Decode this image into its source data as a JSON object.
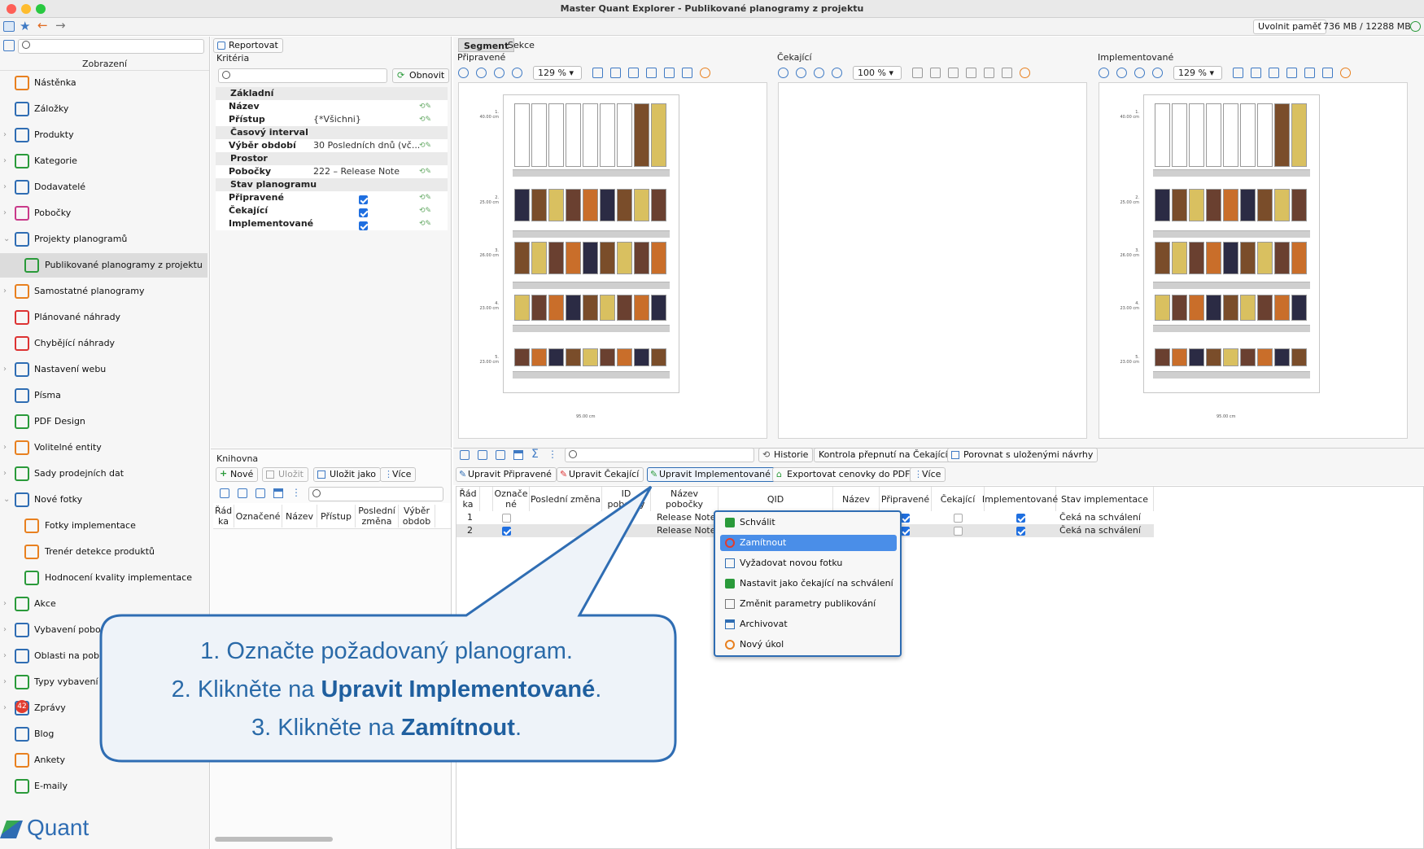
{
  "window": {
    "title": "Master Quant Explorer - Publikované planogramy z projektu"
  },
  "memory": {
    "label": "Uvolnit paměť",
    "value": "736 MB / 12288 MB"
  },
  "sidebar": {
    "section_title": "Zobrazení",
    "items": [
      {
        "label": "Nástěnka"
      },
      {
        "label": "Záložky"
      },
      {
        "label": "Produkty"
      },
      {
        "label": "Kategorie"
      },
      {
        "label": "Dodavatelé"
      },
      {
        "label": "Pobočky"
      },
      {
        "label": "Projekty planogramů"
      },
      {
        "label": "Publikované planogramy z projektu"
      },
      {
        "label": "Samostatné planogramy"
      },
      {
        "label": "Plánované náhrady"
      },
      {
        "label": "Chybějící náhrady"
      },
      {
        "label": "Nastavení webu"
      },
      {
        "label": "Písma"
      },
      {
        "label": "PDF Design"
      },
      {
        "label": "Volitelné entity"
      },
      {
        "label": "Sady prodejních dat"
      },
      {
        "label": "Nové fotky"
      },
      {
        "label": "Fotky implementace"
      },
      {
        "label": "Trenér detekce produktů"
      },
      {
        "label": "Hodnocení kvality implementace"
      },
      {
        "label": "Akce"
      },
      {
        "label": "Vybavení poboč"
      },
      {
        "label": "Oblasti na pobo"
      },
      {
        "label": "Typy vybavení"
      },
      {
        "label": "Zprávy"
      },
      {
        "label": "Blog"
      },
      {
        "label": "Ankety"
      },
      {
        "label": "E-maily"
      }
    ],
    "messages_badge": "42",
    "logo": "Quant"
  },
  "criteria": {
    "report_button": "Reportovat",
    "title": "Kritéria",
    "refresh_button": "Obnovit",
    "groups": {
      "basic": "Základní",
      "time": "Časový interval",
      "space": "Prostor",
      "state": "Stav planogramu"
    },
    "rows": {
      "name": {
        "key": "Název",
        "value": ""
      },
      "access": {
        "key": "Přístup",
        "value": "{*Všichni}"
      },
      "period": {
        "key": "Výběr období",
        "value": "30 Posledních dnů (vč..."
      },
      "branches": {
        "key": "Pobočky",
        "value": "222 – Release Note"
      },
      "prepared": {
        "key": "Připravené"
      },
      "waiting": {
        "key": "Čekající"
      },
      "implemented": {
        "key": "Implementované"
      }
    }
  },
  "library": {
    "title": "Knihovna",
    "new_button": "Nové",
    "save_button": "Uložit",
    "save_as_button": "Uložit jako",
    "more_button": "Více",
    "columns": [
      "Řád ka",
      "Označené",
      "Název",
      "Přístup",
      "Poslední změna",
      "Výběr obdob"
    ]
  },
  "tabs": {
    "segment": "Segment",
    "sekce": "Sekce"
  },
  "viewers": [
    {
      "title": "Připravené",
      "zoom": "129 %"
    },
    {
      "title": "Čekající",
      "zoom": "100 %"
    },
    {
      "title": "Implementované",
      "zoom": "129 %"
    }
  ],
  "planogram": {
    "shelf_labels": [
      "1.\n40.00 cm",
      "2.\n25.00 cm",
      "3.\n26.00 cm",
      "4.\n23.00 cm",
      "5.\n23.00 cm"
    ],
    "width_label": "95.00 cm"
  },
  "grid_toolbar": {
    "history": "Historie",
    "check_switch": "Kontrola přepnutí na Čekající",
    "compare": "Porovnat s uloženými návrhy",
    "edit_prepared": "Upravit Připravené",
    "edit_waiting": "Upravit Čekající",
    "edit_implemented": "Upravit Implementované",
    "export_price": "Exportovat cenovky do PDF",
    "more": "Více"
  },
  "table": {
    "columns": [
      "Řád ka",
      "",
      "Označe né",
      "Poslední změna",
      "ID pobočky",
      "Název pobočky",
      "QID",
      "Název",
      "Připravené",
      "Čekající",
      "Implementované",
      "Stav implementace"
    ],
    "rows": [
      {
        "num": "1",
        "branch": "Release Note",
        "state": "Čeká na schválení"
      },
      {
        "num": "2",
        "branch": "Release Note",
        "state": "Čeká na schválení"
      }
    ]
  },
  "context_menu": {
    "items": [
      "Schválit",
      "Zamítnout",
      "Vyžadovat novou fotku",
      "Nastavit jako čekající na schválení",
      "Změnit parametry publikování",
      "Archivovat",
      "Nový úkol"
    ]
  },
  "callout": {
    "line1": "1. Označte požadovaný planogram.",
    "line2_pre": "2. Klikněte na ",
    "line2_bold": "Upravit Implementované",
    "line2_post": ".",
    "line3_pre": "3. Klikněte na ",
    "line3_bold": "Zamítnout",
    "line3_post": "."
  },
  "colors": {
    "accent": "#2f6db3",
    "menu_highlight": "#4a8ee8",
    "callout_fill": "#eef3f9"
  }
}
